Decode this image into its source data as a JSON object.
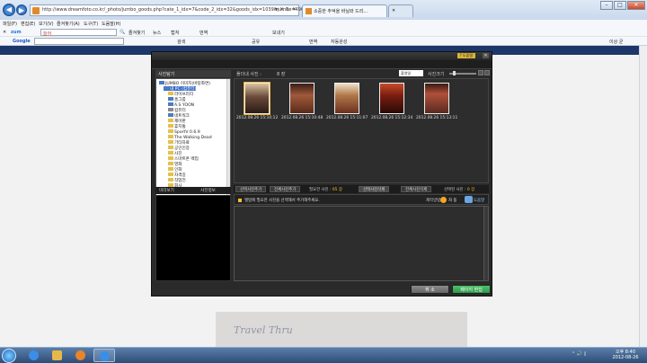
{
  "browser": {
    "url": "http://www.dreamfoto.co.kr/_photo/jumbo_goods.php?cate_1_idx=7&code_2_idx=32&goods_idx=1039&jumbo=4965",
    "address_tools": "▾ ✕ ↻ ✕",
    "tabs": [
      {
        "label": "소중한 추억을 바닐와 드리..."
      },
      {
        "label": "✕"
      }
    ]
  },
  "menu": {
    "items": [
      "파일(F)",
      "편집(E)",
      "보기(V)",
      "즐겨찾기(A)",
      "도구(T)",
      "도움말(H)"
    ]
  },
  "toolbar1": {
    "zum": "zum",
    "search_value": "늘어",
    "items": [
      "즐겨찾기",
      "뉴스",
      "캡쳐",
      "번역",
      "보내기"
    ]
  },
  "toolbar2": {
    "google": "Google",
    "items": [
      "검색",
      "공유",
      "번역",
      "자동완성",
      "검색",
      "번역",
      "자동완성"
    ],
    "right": "이상 균"
  },
  "dialog": {
    "help_label": "? 도움말",
    "folder_header": "사진탐기",
    "folder_tree": [
      {
        "label": "JUMBO 이미지(바탕화면)",
        "kind": "blue",
        "indent": 0
      },
      {
        "label": "내 PC (컴퓨터)",
        "kind": "blue",
        "indent": 1,
        "selected": true
      },
      {
        "label": "라이브러리",
        "kind": "folder",
        "indent": 2
      },
      {
        "label": "홈그룹",
        "kind": "blue",
        "indent": 2
      },
      {
        "label": "A.S YOON",
        "kind": "blue",
        "indent": 2
      },
      {
        "label": "컴퓨터",
        "kind": "drive",
        "indent": 2
      },
      {
        "label": "네트워크",
        "kind": "blue",
        "indent": 2
      },
      {
        "label": "제어판",
        "kind": "folder",
        "indent": 2
      },
      {
        "label": "휴지통",
        "kind": "folder",
        "indent": 2
      },
      {
        "label": "SportV 0.6.9",
        "kind": "folder",
        "indent": 2
      },
      {
        "label": "The Walking Dead",
        "kind": "folder",
        "indent": 2
      },
      {
        "label": "기타자료",
        "kind": "folder",
        "indent": 2
      },
      {
        "label": "공인인증",
        "kind": "folder",
        "indent": 2
      },
      {
        "label": "사진",
        "kind": "folder",
        "indent": 2
      },
      {
        "label": "스마트폰 백업",
        "kind": "folder",
        "indent": 2
      },
      {
        "label": "영화",
        "kind": "folder",
        "indent": 2
      },
      {
        "label": "인화",
        "kind": "folder",
        "indent": 2
      },
      {
        "label": "자격증",
        "kind": "folder",
        "indent": 2
      },
      {
        "label": "작업전",
        "kind": "folder",
        "indent": 2
      },
      {
        "label": "회사",
        "kind": "folder",
        "indent": 2
      }
    ],
    "thumb_header": {
      "label": "폴더내 사진 :",
      "count": "8 장",
      "sort": "촬영일",
      "size_label": "사진크기"
    },
    "thumbnails": [
      {
        "caption": "2012.08.26 15:10:12",
        "selected": true
      },
      {
        "caption": "2012.08.26 15:10:48",
        "selected": false
      },
      {
        "caption": "2012.08.26 15:11:07",
        "selected": false
      },
      {
        "caption": "2012.08.26 15:12:34",
        "selected": false
      },
      {
        "caption": "2012.08.26 15:13:11",
        "selected": false
      }
    ],
    "tabs": [
      "선택사진추가",
      "전체사진추가"
    ],
    "needed_label": "필요한 사진 :",
    "needed_value": "65 장",
    "tabs_right": [
      "선택사진삭제",
      "전체사진삭제"
    ],
    "selected_label": "선택된 사진 :",
    "selected_value": "0 장",
    "side_tabs": [
      "미리보기",
      "사진정보"
    ],
    "notice": "앨범에 필요한 사진을 선택해서 추가해주세요.",
    "order_label": "제작방법",
    "order_value": "자 동",
    "tip_label": "도움말",
    "cancel_label": "취 소",
    "edit_label": "페이지 편집"
  },
  "page": {
    "preview_text": "Travel Thru"
  },
  "taskbar": {
    "tray": "⌃ 🔊 ▯",
    "time": "오후 8:40",
    "date": "2012-08-26"
  },
  "colors": {
    "dialog_bg": "#2a2a2a",
    "accent_yellow": "#f2c02c",
    "edit_green": "#3bb15a",
    "selection_blue": "#3a6ec8"
  }
}
